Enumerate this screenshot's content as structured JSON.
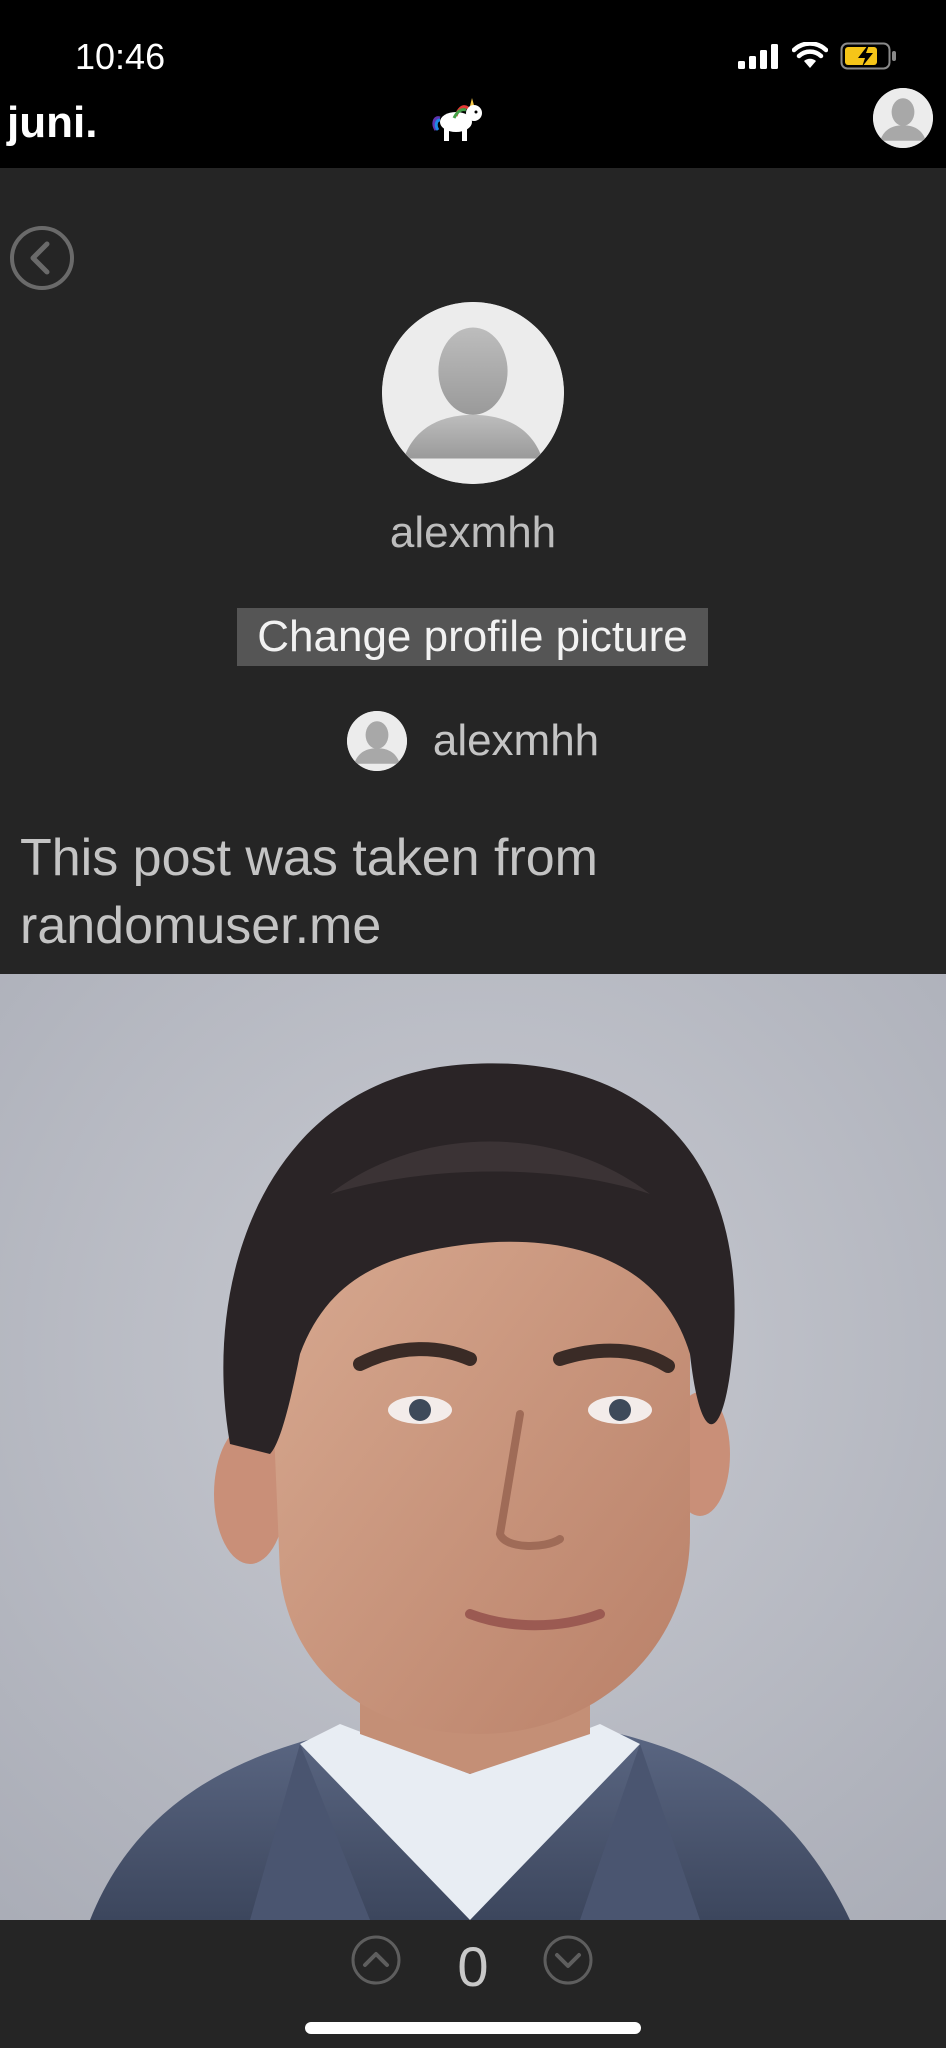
{
  "status_bar": {
    "time": "10:46"
  },
  "header": {
    "brand": "juni."
  },
  "profile": {
    "username": "alexmhh",
    "change_picture_label": "Change profile picture"
  },
  "post": {
    "author": "alexmhh",
    "text": "This post was taken from randomuser.me",
    "vote_count": "0"
  },
  "colors": {
    "background": "#252525",
    "bars": "#000000",
    "button_bg": "#555555",
    "battery_fill": "#f5c518"
  },
  "icons": {
    "back": "chevron-left-circle-icon",
    "upvote": "chevron-up-circle-icon",
    "downvote": "chevron-down-circle-icon",
    "mascot": "unicorn-icon",
    "avatar": "default-person-icon"
  }
}
